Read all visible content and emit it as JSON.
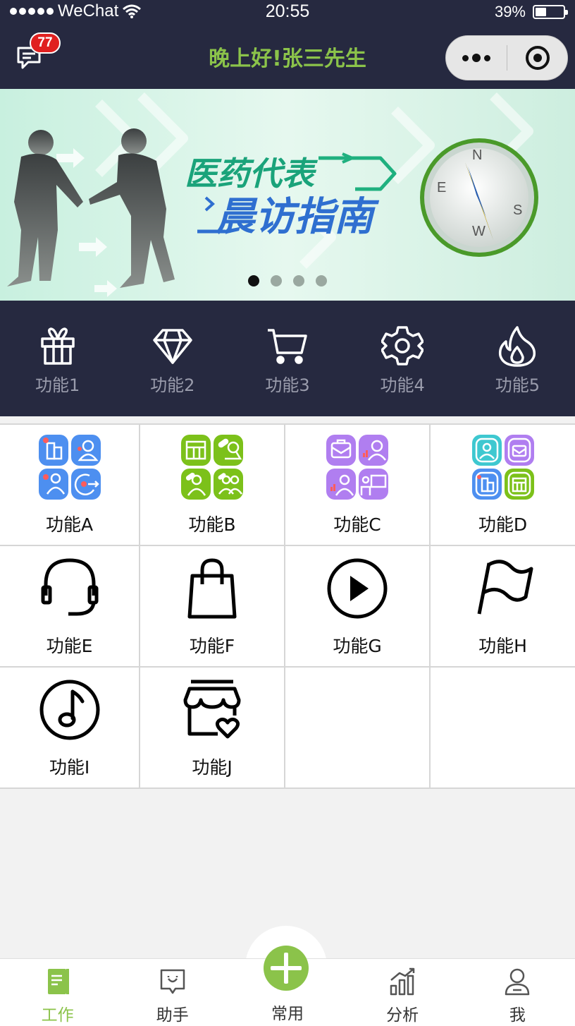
{
  "status_bar": {
    "carrier": "WeChat",
    "time": "20:55",
    "battery": "39%",
    "battery_level": 0.39
  },
  "nav": {
    "title": "晚上好!张三先生",
    "message_badge": "77",
    "more_icon": "ellipsis-icon",
    "close_icon": "target-close-icon"
  },
  "banner": {
    "line1": "医药代表",
    "line2": "晨访指南",
    "compass": [
      "N",
      "E",
      "S",
      "W"
    ],
    "slide_count": 4,
    "active_slide": 0
  },
  "quick_functions": [
    {
      "label": "功能1",
      "icon": "gift-icon"
    },
    {
      "label": "功能2",
      "icon": "diamond-icon"
    },
    {
      "label": "功能3",
      "icon": "cart-icon"
    },
    {
      "label": "功能4",
      "icon": "gear-icon"
    },
    {
      "label": "功能5",
      "icon": "flame-icon"
    }
  ],
  "grid_functions": [
    {
      "label": "功能A",
      "icon": "blue-tiles-icon"
    },
    {
      "label": "功能B",
      "icon": "green-tiles-icon"
    },
    {
      "label": "功能C",
      "icon": "purple-tiles-icon"
    },
    {
      "label": "功能D",
      "icon": "mixed-tiles-icon"
    },
    {
      "label": "功能E",
      "icon": "headset-icon"
    },
    {
      "label": "功能F",
      "icon": "shopping-bag-icon"
    },
    {
      "label": "功能G",
      "icon": "play-icon"
    },
    {
      "label": "功能H",
      "icon": "flag-icon"
    },
    {
      "label": "功能I",
      "icon": "music-note-icon"
    },
    {
      "label": "功能J",
      "icon": "store-heart-icon"
    }
  ],
  "tabs": [
    {
      "label": "工作",
      "icon": "notebook-icon",
      "active": true
    },
    {
      "label": "助手",
      "icon": "chat-smile-icon",
      "active": false
    },
    {
      "label": "常用",
      "icon": "plus-icon",
      "active": false
    },
    {
      "label": "分析",
      "icon": "chart-icon",
      "active": false
    },
    {
      "label": "我",
      "icon": "user-icon",
      "active": false
    }
  ],
  "colors": {
    "header_bg": "#262940",
    "accent_green": "#8bc34a",
    "badge_red": "#e02020",
    "tile_blue": "#4d8ff0",
    "tile_green": "#7cc11a",
    "tile_purple": "#b07ef0",
    "tile_cyan": "#3ec8d0"
  }
}
